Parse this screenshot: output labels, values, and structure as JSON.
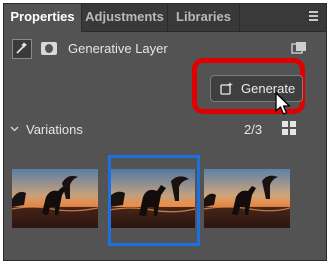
{
  "tabs": [
    {
      "label": "Properties",
      "active": true
    },
    {
      "label": "Adjustments",
      "active": false
    },
    {
      "label": "Libraries",
      "active": false
    }
  ],
  "layer": {
    "title": "Generative Layer"
  },
  "generate_button": {
    "label": "Generate",
    "icon": "generate-sparkle-icon"
  },
  "variations": {
    "title": "Variations",
    "count": "2/3",
    "selected_index": 1,
    "thumbnails": [
      {
        "name": "variation-1",
        "description_icon": "dinosaur-sunset-thumbnail"
      },
      {
        "name": "variation-2",
        "description_icon": "dinosaur-sunset-thumbnail"
      },
      {
        "name": "variation-3",
        "description_icon": "dinosaur-sunset-thumbnail"
      }
    ]
  },
  "colors": {
    "panel_bg": "#535353",
    "tabbar_bg": "#393939",
    "highlight_red": "#e00000",
    "selection_blue": "#1e6fe0"
  }
}
